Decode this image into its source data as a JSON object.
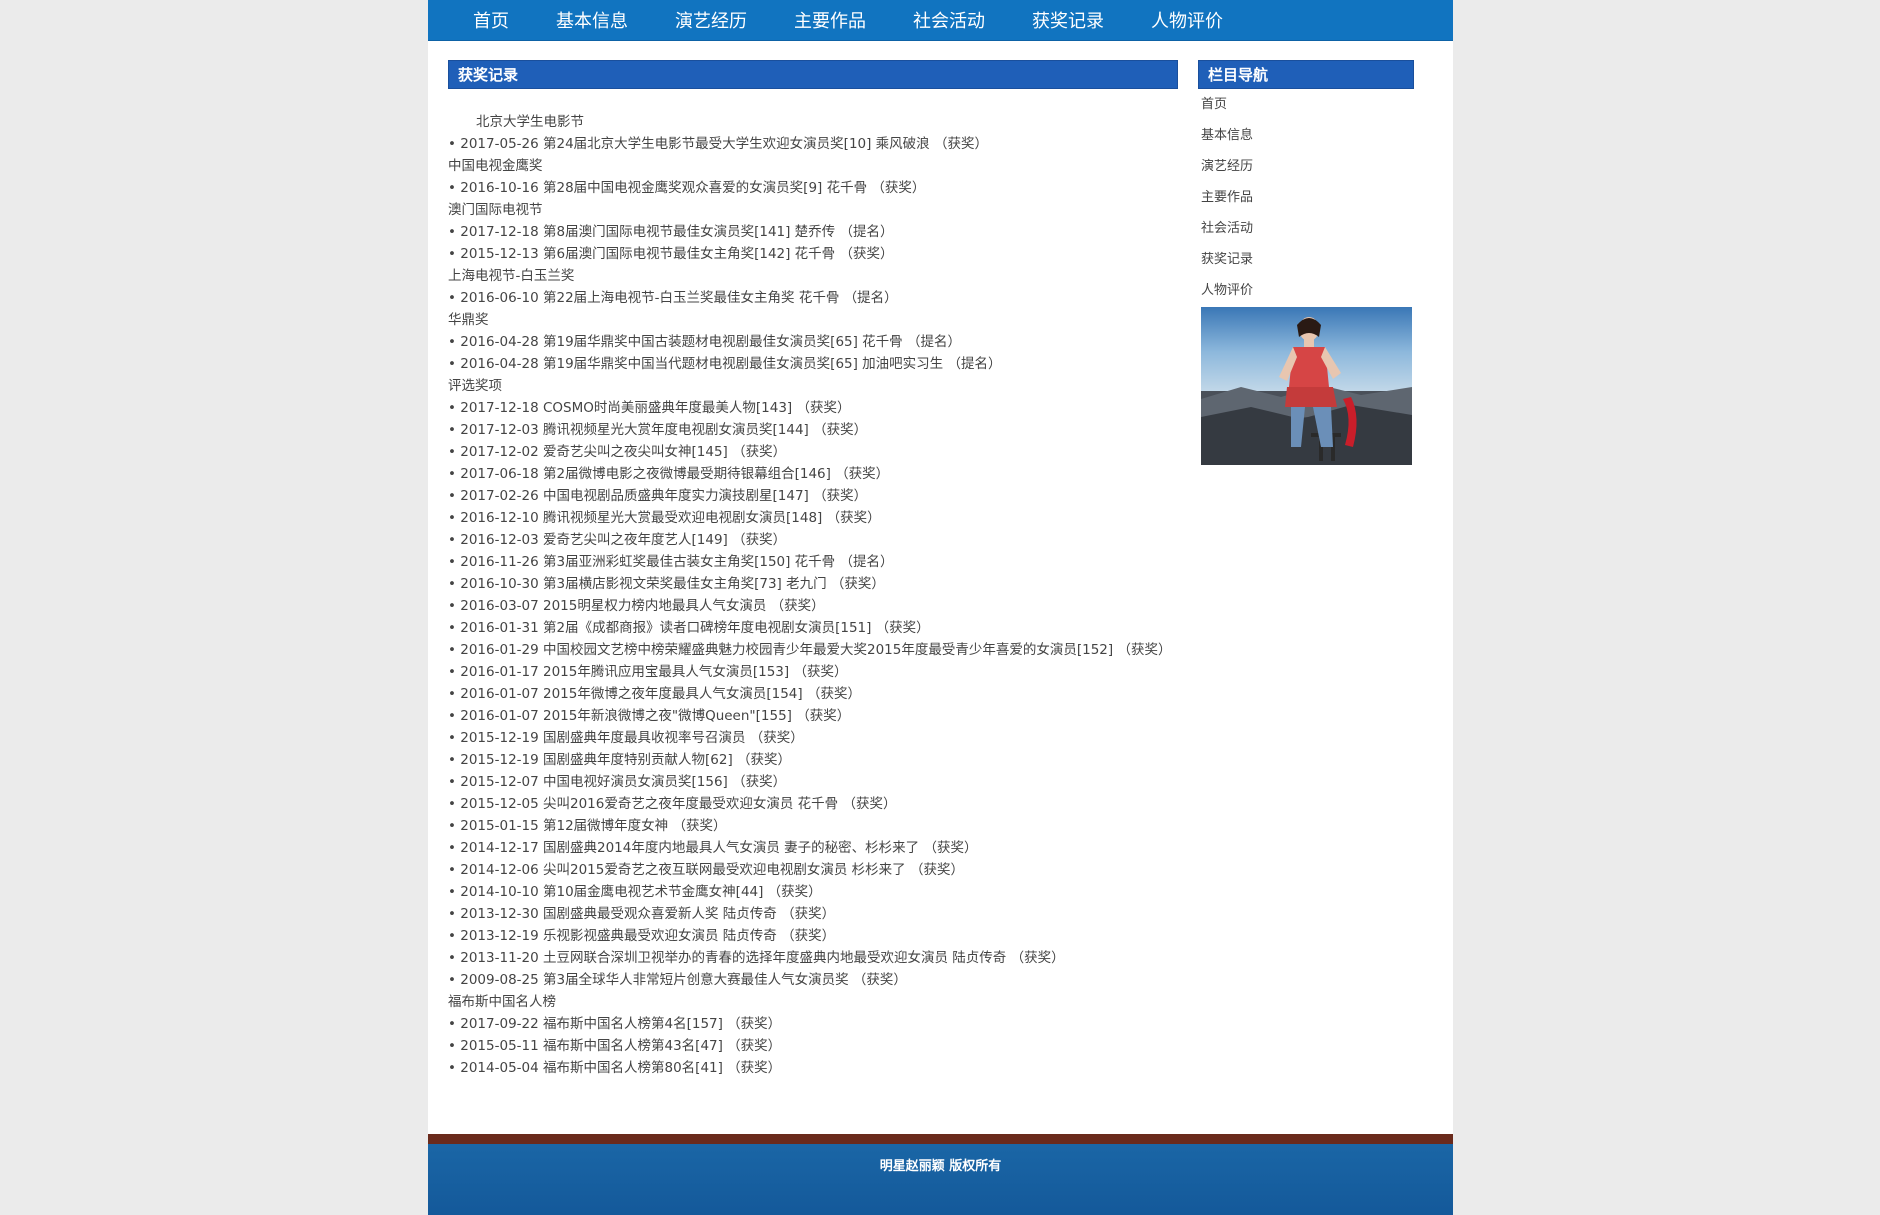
{
  "nav": [
    "首页",
    "基本信息",
    "演艺经历",
    "主要作品",
    "社会活动",
    "获奖记录",
    "人物评价"
  ],
  "main": {
    "title": "获奖记录",
    "lines": [
      {
        "type": "cat",
        "text": "北京大学生电影节"
      },
      {
        "type": "item",
        "text": "• 2017-05-26 第24届北京大学生电影节最受大学生欢迎女演员奖[10] 乘风破浪 （获奖）"
      },
      {
        "type": "cat",
        "text": "中国电视金鹰奖"
      },
      {
        "type": "item",
        "text": "• 2016-10-16 第28届中国电视金鹰奖观众喜爱的女演员奖[9] 花千骨 （获奖）"
      },
      {
        "type": "cat",
        "text": "澳门国际电视节"
      },
      {
        "type": "item",
        "text": "• 2017-12-18 第8届澳门国际电视节最佳女演员奖[141] 楚乔传 （提名）"
      },
      {
        "type": "item",
        "text": "• 2015-12-13 第6届澳门国际电视节最佳女主角奖[142] 花千骨 （获奖）"
      },
      {
        "type": "cat",
        "text": "上海电视节-白玉兰奖"
      },
      {
        "type": "item",
        "text": "• 2016-06-10 第22届上海电视节-白玉兰奖最佳女主角奖 花千骨 （提名）"
      },
      {
        "type": "cat",
        "text": "华鼎奖"
      },
      {
        "type": "item",
        "text": "• 2016-04-28 第19届华鼎奖中国古装题材电视剧最佳女演员奖[65] 花千骨 （提名）"
      },
      {
        "type": "item",
        "text": "• 2016-04-28 第19届华鼎奖中国当代题材电视剧最佳女演员奖[65] 加油吧实习生 （提名）"
      },
      {
        "type": "cat",
        "text": "评选奖项"
      },
      {
        "type": "item",
        "text": "• 2017-12-18 COSMO时尚美丽盛典年度最美人物[143] （获奖）"
      },
      {
        "type": "item",
        "text": "• 2017-12-03 腾讯视频星光大赏年度电视剧女演员奖[144] （获奖）"
      },
      {
        "type": "item",
        "text": "• 2017-12-02 爱奇艺尖叫之夜尖叫女神[145] （获奖）"
      },
      {
        "type": "item",
        "text": "• 2017-06-18 第2届微博电影之夜微博最受期待银幕组合[146] （获奖）"
      },
      {
        "type": "item",
        "text": "• 2017-02-26 中国电视剧品质盛典年度实力演技剧星[147] （获奖）"
      },
      {
        "type": "item",
        "text": "• 2016-12-10 腾讯视频星光大赏最受欢迎电视剧女演员[148] （获奖）"
      },
      {
        "type": "item",
        "text": "• 2016-12-03 爱奇艺尖叫之夜年度艺人[149] （获奖）"
      },
      {
        "type": "item",
        "text": "• 2016-11-26 第3届亚洲彩虹奖最佳古装女主角奖[150] 花千骨 （提名）"
      },
      {
        "type": "item",
        "text": "• 2016-10-30 第3届横店影视文荣奖最佳女主角奖[73] 老九门 （获奖）"
      },
      {
        "type": "item",
        "text": "• 2016-03-07 2015明星权力榜内地最具人气女演员 （获奖）"
      },
      {
        "type": "item",
        "text": "• 2016-01-31 第2届《成都商报》读者口碑榜年度电视剧女演员[151] （获奖）"
      },
      {
        "type": "item",
        "text": "• 2016-01-29 中国校园文艺榜中榜荣耀盛典魅力校园青少年最爱大奖2015年度最受青少年喜爱的女演员[152] （获奖）"
      },
      {
        "type": "item",
        "text": "• 2016-01-17 2015年腾讯应用宝最具人气女演员[153] （获奖）"
      },
      {
        "type": "item",
        "text": "• 2016-01-07 2015年微博之夜年度最具人气女演员[154] （获奖）"
      },
      {
        "type": "item",
        "text": "• 2016-01-07 2015年新浪微博之夜\"微博Queen\"[155] （获奖）"
      },
      {
        "type": "item",
        "text": "• 2015-12-19 国剧盛典年度最具收视率号召演员 （获奖）"
      },
      {
        "type": "item",
        "text": "• 2015-12-19 国剧盛典年度特别贡献人物[62] （获奖）"
      },
      {
        "type": "item",
        "text": "• 2015-12-07 中国电视好演员女演员奖[156] （获奖）"
      },
      {
        "type": "item",
        "text": "• 2015-12-05 尖叫2016爱奇艺之夜年度最受欢迎女演员 花千骨 （获奖）"
      },
      {
        "type": "item",
        "text": "• 2015-01-15 第12届微博年度女神 （获奖）"
      },
      {
        "type": "item",
        "text": "• 2014-12-17 国剧盛典2014年度内地最具人气女演员 妻子的秘密、杉杉来了 （获奖）"
      },
      {
        "type": "item",
        "text": "• 2014-12-06 尖叫2015爱奇艺之夜互联网最受欢迎电视剧女演员 杉杉来了 （获奖）"
      },
      {
        "type": "item",
        "text": "• 2014-10-10 第10届金鹰电视艺术节金鹰女神[44] （获奖）"
      },
      {
        "type": "item",
        "text": "• 2013-12-30 国剧盛典最受观众喜爱新人奖 陆贞传奇 （获奖）"
      },
      {
        "type": "item",
        "text": "• 2013-12-19 乐视影视盛典最受欢迎女演员 陆贞传奇 （获奖）"
      },
      {
        "type": "item",
        "text": "• 2013-11-20 土豆网联合深圳卫视举办的青春的选择年度盛典内地最受欢迎女演员 陆贞传奇 （获奖）"
      },
      {
        "type": "item",
        "text": "• 2009-08-25 第3届全球华人非常短片创意大赛最佳人气女演员奖 （获奖）"
      },
      {
        "type": "cat",
        "text": "福布斯中国名人榜"
      },
      {
        "type": "item",
        "text": "• 2017-09-22 福布斯中国名人榜第4名[157] （获奖）"
      },
      {
        "type": "item",
        "text": "• 2015-05-11 福布斯中国名人榜第43名[47] （获奖）"
      },
      {
        "type": "item",
        "text": "• 2014-05-04 福布斯中国名人榜第80名[41] （获奖）"
      }
    ]
  },
  "sidebar": {
    "title": "栏目导航",
    "items": [
      "首页",
      "基本信息",
      "演艺经历",
      "主要作品",
      "社会活动",
      "获奖记录",
      "人物评价"
    ]
  },
  "footer": {
    "text": "明星赵丽颖 版权所有"
  }
}
